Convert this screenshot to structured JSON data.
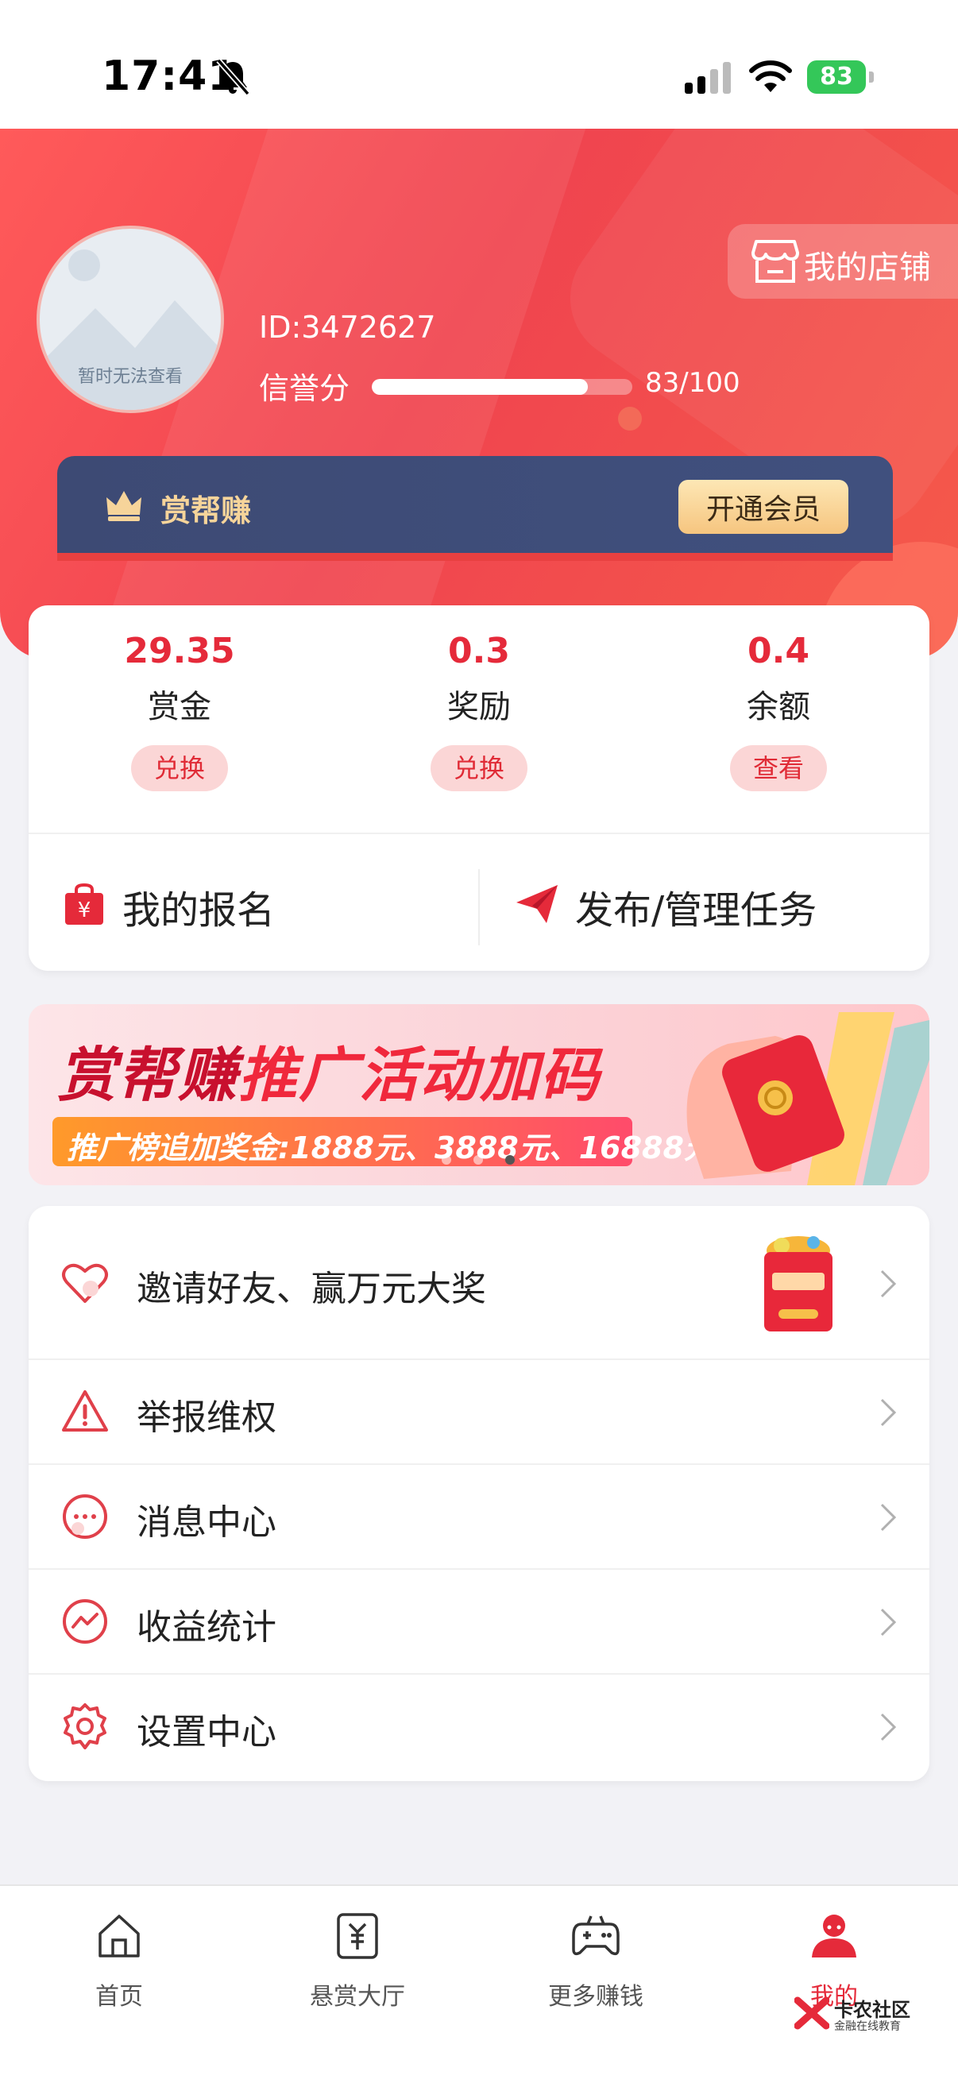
{
  "status_bar": {
    "time": "17:41",
    "battery": "83"
  },
  "profile": {
    "avatar_text": "暂时无法查看",
    "user_id": "ID:3472627",
    "credit_label": "信誉分",
    "credit_value": "83/100",
    "credit_fraction": 0.83,
    "store_label": "我的店铺"
  },
  "vip": {
    "title": "赏帮赚",
    "button_label": "开通会员"
  },
  "stats": [
    {
      "value": "29.35",
      "label": "赏金",
      "action": "兑换"
    },
    {
      "value": "0.3",
      "label": "奖励",
      "action": "兑换"
    },
    {
      "value": "0.4",
      "label": "余额",
      "action": "查看"
    }
  ],
  "quick_actions": [
    {
      "label": "我的报名"
    },
    {
      "label": "发布/管理任务"
    }
  ],
  "banner": {
    "title_part1": "赏帮赚",
    "title_part2": "推广活动加码",
    "subtitle": "推广榜追加奖金:1888元、3888元、16888元"
  },
  "menu": [
    {
      "label": "邀请好友、赢万元大奖",
      "icon": "heart-icon"
    },
    {
      "label": "举报维权",
      "icon": "warning-icon"
    },
    {
      "label": "消息中心",
      "icon": "message-icon"
    },
    {
      "label": "收益统计",
      "icon": "chart-icon"
    },
    {
      "label": "设置中心",
      "icon": "gear-icon"
    }
  ],
  "tabs": [
    {
      "label": "首页",
      "icon": "home-icon"
    },
    {
      "label": "悬赏大厅",
      "icon": "bounty-icon"
    },
    {
      "label": "更多赚钱",
      "icon": "gamepad-icon"
    },
    {
      "label": "我的",
      "icon": "user-icon",
      "active": true
    }
  ],
  "watermark": {
    "name": "卡农社区",
    "tagline": "金融在线教育"
  },
  "colors": {
    "primary": "#e52a3a",
    "header": "#f0444f",
    "vip_bg": "#3d4a74",
    "vip_gold": "#f6d49a"
  }
}
